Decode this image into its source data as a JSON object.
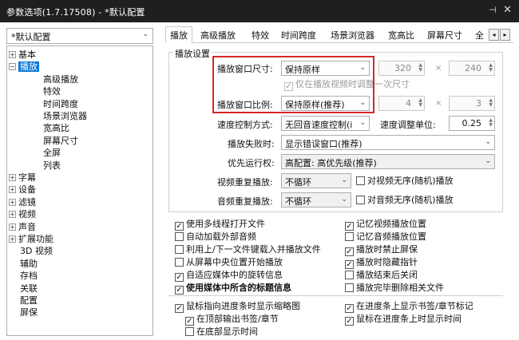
{
  "window": {
    "title": "参数选项(1.7.17508) - *默认配置",
    "pin": "⊣",
    "close": "✕"
  },
  "sidebar": {
    "preset": "*默认配置",
    "tree": [
      {
        "label": "基本",
        "expand": "+",
        "level": 0
      },
      {
        "label": "播放",
        "expand": "−",
        "level": 0,
        "selected": true
      },
      {
        "label": "高级播放",
        "level": 1
      },
      {
        "label": "特效",
        "level": 1
      },
      {
        "label": "时间跨度",
        "level": 1
      },
      {
        "label": "场景浏览器",
        "level": 1
      },
      {
        "label": "宽高比",
        "level": 1
      },
      {
        "label": "屏幕尺寸",
        "level": 1
      },
      {
        "label": "全屏",
        "level": 1
      },
      {
        "label": "列表",
        "level": 1
      },
      {
        "label": "字幕",
        "expand": "+",
        "level": 0
      },
      {
        "label": "设备",
        "expand": "+",
        "level": 0
      },
      {
        "label": "滤镜",
        "expand": "+",
        "level": 0
      },
      {
        "label": "视频",
        "expand": "+",
        "level": 0
      },
      {
        "label": "声音",
        "expand": "+",
        "level": 0
      },
      {
        "label": "扩展功能",
        "expand": "+",
        "level": 0
      },
      {
        "label": "3D 视频",
        "level": 0
      },
      {
        "label": "辅助",
        "level": 0
      },
      {
        "label": "存档",
        "level": 0
      },
      {
        "label": "关联",
        "level": 0
      },
      {
        "label": "配置",
        "level": 0
      },
      {
        "label": "屏保",
        "level": 0
      }
    ]
  },
  "tabs": [
    "播放",
    "高级播放",
    "特效",
    "时间跨度",
    "场景浏览器",
    "宽高比",
    "屏幕尺寸",
    "全"
  ],
  "tab_arrows": [
    "◂",
    "▸"
  ],
  "settings": {
    "group_title": "播放设置",
    "window_size_label": "播放窗口尺寸:",
    "window_size_value": "保持原样",
    "size_w": "320",
    "size_h": "240",
    "times": "×",
    "only_once_label": "仅在播放视频时调整一次尺寸",
    "ratio_label": "播放窗口比例:",
    "ratio_value": "保持原样(推荐)",
    "ratio_w": "4",
    "ratio_h": "3",
    "speed_mode_label": "速度控制方式:",
    "speed_mode_value": "无回音速度控制(i",
    "speed_unit_label": "速度调整单位:",
    "speed_unit_value": "0.25",
    "fail_label": "播放失败时:",
    "fail_value": "显示错误窗口(推荐)",
    "priority_label": "优先运行权:",
    "priority_value": "高配置: 高优先级(推荐)",
    "video_repeat_label": "视频重复播放:",
    "video_repeat_value": "不循环",
    "video_random_label": "对视频无序(随机)播放",
    "audio_repeat_label": "音频重复播放:",
    "audio_repeat_value": "不循环",
    "audio_random_label": "对音频无序(随机)播放"
  },
  "checks_left": [
    {
      "label": "使用多线程打开文件",
      "checked": true
    },
    {
      "label": "自动加载外部音频",
      "checked": false
    },
    {
      "label": "利用上/下一文件键载入并播放文件",
      "checked": false
    },
    {
      "label": "从屏幕中央位置开始播放",
      "checked": false
    },
    {
      "label": "自适应媒体中的旋转信息",
      "checked": true
    },
    {
      "label": "使用媒体中所含的标题信息",
      "checked": true,
      "bold": true
    }
  ],
  "checks_right": [
    {
      "label": "记忆视频播放位置",
      "checked": true
    },
    {
      "label": "记忆音频播放位置",
      "checked": false
    },
    {
      "label": "播放时禁止屏保",
      "checked": true
    },
    {
      "label": "播放时隐藏指针",
      "checked": true
    },
    {
      "label": "播放结束后关闭",
      "checked": false
    },
    {
      "label": "播放完毕删除相关文件",
      "checked": false
    }
  ],
  "checks_bottom": {
    "thumb": "鼠标指向进度条时显示缩略图",
    "thumb_top": "在顶部输出书签/章节",
    "thumb_bottom": "在底部显示时间",
    "show_marks": "在进度条上显示书签/章节标记",
    "show_time": "鼠标在进度条上时显示时间"
  },
  "icons": {
    "checked": "✓",
    "arrow": "⌄",
    "spin_up": "▲",
    "spin_down": "▼"
  },
  "colors": {
    "selection": "#0a78d7",
    "highlight": "#d62727",
    "titlebar": "#1f1f1f"
  }
}
